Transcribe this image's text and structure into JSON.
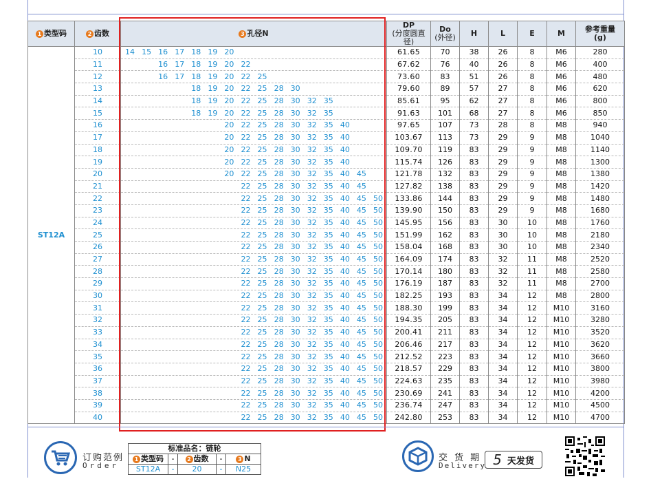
{
  "headers": {
    "type_code": "类型码",
    "teeth": "齿数",
    "bore": "孔径N",
    "dp_top": "DP",
    "dp_sub": "(分度圆直径)",
    "do_top": "Do",
    "do_sub": "(外径)",
    "h": "H",
    "l": "L",
    "e": "E",
    "m": "M",
    "weight_top": "参考重量",
    "weight_unit": "(g)",
    "num1": "1",
    "num2": "2",
    "num3": "3"
  },
  "type_value": "ST12A",
  "rows": [
    {
      "t": "10",
      "bores": [
        "14",
        "15",
        "16",
        "17",
        "18",
        "19",
        "20",
        "",
        "",
        "",
        "",
        "",
        "",
        "",
        "",
        ""
      ],
      "dp": "61.65",
      "do": "70",
      "h": "38",
      "l": "26",
      "e": "8",
      "m": "M6",
      "w": "280"
    },
    {
      "t": "11",
      "bores": [
        "",
        "",
        "16",
        "17",
        "18",
        "19",
        "20",
        "22",
        "",
        "",
        "",
        "",
        "",
        "",
        "",
        ""
      ],
      "dp": "67.62",
      "do": "76",
      "h": "40",
      "l": "26",
      "e": "8",
      "m": "M6",
      "w": "400"
    },
    {
      "t": "12",
      "bores": [
        "",
        "",
        "16",
        "17",
        "18",
        "19",
        "20",
        "22",
        "25",
        "",
        "",
        "",
        "",
        "",
        "",
        ""
      ],
      "dp": "73.60",
      "do": "83",
      "h": "51",
      "l": "26",
      "e": "8",
      "m": "M6",
      "w": "480"
    },
    {
      "t": "13",
      "bores": [
        "",
        "",
        "",
        "",
        "18",
        "19",
        "20",
        "22",
        "25",
        "28",
        "30",
        "",
        "",
        "",
        "",
        ""
      ],
      "dp": "79.60",
      "do": "89",
      "h": "57",
      "l": "27",
      "e": "8",
      "m": "M6",
      "w": "620"
    },
    {
      "t": "14",
      "bores": [
        "",
        "",
        "",
        "",
        "18",
        "19",
        "20",
        "22",
        "25",
        "28",
        "30",
        "32",
        "35",
        "",
        "",
        ""
      ],
      "dp": "85.61",
      "do": "95",
      "h": "62",
      "l": "27",
      "e": "8",
      "m": "M6",
      "w": "800"
    },
    {
      "t": "15",
      "bores": [
        "",
        "",
        "",
        "",
        "18",
        "19",
        "20",
        "22",
        "25",
        "28",
        "30",
        "32",
        "35",
        "",
        "",
        ""
      ],
      "dp": "91.63",
      "do": "101",
      "h": "68",
      "l": "27",
      "e": "8",
      "m": "M6",
      "w": "850"
    },
    {
      "t": "16",
      "bores": [
        "",
        "",
        "",
        "",
        "",
        "",
        "20",
        "22",
        "25",
        "28",
        "30",
        "32",
        "35",
        "40",
        "",
        ""
      ],
      "dp": "97.65",
      "do": "107",
      "h": "73",
      "l": "28",
      "e": "8",
      "m": "M8",
      "w": "940"
    },
    {
      "t": "17",
      "bores": [
        "",
        "",
        "",
        "",
        "",
        "",
        "20",
        "22",
        "25",
        "28",
        "30",
        "32",
        "35",
        "40",
        "",
        ""
      ],
      "dp": "103.67",
      "do": "113",
      "h": "73",
      "l": "29",
      "e": "9",
      "m": "M8",
      "w": "1040"
    },
    {
      "t": "18",
      "bores": [
        "",
        "",
        "",
        "",
        "",
        "",
        "20",
        "22",
        "25",
        "28",
        "30",
        "32",
        "35",
        "40",
        "",
        ""
      ],
      "dp": "109.70",
      "do": "119",
      "h": "83",
      "l": "29",
      "e": "9",
      "m": "M8",
      "w": "1140"
    },
    {
      "t": "19",
      "bores": [
        "",
        "",
        "",
        "",
        "",
        "",
        "20",
        "22",
        "25",
        "28",
        "30",
        "32",
        "35",
        "40",
        "",
        ""
      ],
      "dp": "115.74",
      "do": "126",
      "h": "83",
      "l": "29",
      "e": "9",
      "m": "M8",
      "w": "1300"
    },
    {
      "t": "20",
      "bores": [
        "",
        "",
        "",
        "",
        "",
        "",
        "20",
        "22",
        "25",
        "28",
        "30",
        "32",
        "35",
        "40",
        "45",
        ""
      ],
      "dp": "121.78",
      "do": "132",
      "h": "83",
      "l": "29",
      "e": "9",
      "m": "M8",
      "w": "1380"
    },
    {
      "t": "21",
      "bores": [
        "",
        "",
        "",
        "",
        "",
        "",
        "",
        "22",
        "25",
        "28",
        "30",
        "32",
        "35",
        "40",
        "45",
        ""
      ],
      "dp": "127.82",
      "do": "138",
      "h": "83",
      "l": "29",
      "e": "9",
      "m": "M8",
      "w": "1420"
    },
    {
      "t": "22",
      "bores": [
        "",
        "",
        "",
        "",
        "",
        "",
        "",
        "22",
        "25",
        "28",
        "30",
        "32",
        "35",
        "40",
        "45",
        "50"
      ],
      "dp": "133.86",
      "do": "144",
      "h": "83",
      "l": "29",
      "e": "9",
      "m": "M8",
      "w": "1480"
    },
    {
      "t": "23",
      "bores": [
        "",
        "",
        "",
        "",
        "",
        "",
        "",
        "22",
        "25",
        "28",
        "30",
        "32",
        "35",
        "40",
        "45",
        "50"
      ],
      "dp": "139.90",
      "do": "150",
      "h": "83",
      "l": "29",
      "e": "9",
      "m": "M8",
      "w": "1680"
    },
    {
      "t": "24",
      "bores": [
        "",
        "",
        "",
        "",
        "",
        "",
        "",
        "22",
        "25",
        "28",
        "30",
        "32",
        "35",
        "40",
        "45",
        "50"
      ],
      "dp": "145.95",
      "do": "156",
      "h": "83",
      "l": "30",
      "e": "10",
      "m": "M8",
      "w": "1760"
    },
    {
      "t": "25",
      "bores": [
        "",
        "",
        "",
        "",
        "",
        "",
        "",
        "22",
        "25",
        "28",
        "30",
        "32",
        "35",
        "40",
        "45",
        "50"
      ],
      "dp": "151.99",
      "do": "162",
      "h": "83",
      "l": "30",
      "e": "10",
      "m": "M8",
      "w": "2180"
    },
    {
      "t": "26",
      "bores": [
        "",
        "",
        "",
        "",
        "",
        "",
        "",
        "22",
        "25",
        "28",
        "30",
        "32",
        "35",
        "40",
        "45",
        "50"
      ],
      "dp": "158.04",
      "do": "168",
      "h": "83",
      "l": "30",
      "e": "10",
      "m": "M8",
      "w": "2340"
    },
    {
      "t": "27",
      "bores": [
        "",
        "",
        "",
        "",
        "",
        "",
        "",
        "22",
        "25",
        "28",
        "30",
        "32",
        "35",
        "40",
        "45",
        "50"
      ],
      "dp": "164.09",
      "do": "174",
      "h": "83",
      "l": "32",
      "e": "11",
      "m": "M8",
      "w": "2520"
    },
    {
      "t": "28",
      "bores": [
        "",
        "",
        "",
        "",
        "",
        "",
        "",
        "22",
        "25",
        "28",
        "30",
        "32",
        "35",
        "40",
        "45",
        "50"
      ],
      "dp": "170.14",
      "do": "180",
      "h": "83",
      "l": "32",
      "e": "11",
      "m": "M8",
      "w": "2580"
    },
    {
      "t": "29",
      "bores": [
        "",
        "",
        "",
        "",
        "",
        "",
        "",
        "22",
        "25",
        "28",
        "30",
        "32",
        "35",
        "40",
        "45",
        "50"
      ],
      "dp": "176.19",
      "do": "187",
      "h": "83",
      "l": "32",
      "e": "11",
      "m": "M8",
      "w": "2700"
    },
    {
      "t": "30",
      "bores": [
        "",
        "",
        "",
        "",
        "",
        "",
        "",
        "22",
        "25",
        "28",
        "30",
        "32",
        "35",
        "40",
        "45",
        "50"
      ],
      "dp": "182.25",
      "do": "193",
      "h": "83",
      "l": "34",
      "e": "12",
      "m": "M8",
      "w": "2800"
    },
    {
      "t": "31",
      "bores": [
        "",
        "",
        "",
        "",
        "",
        "",
        "",
        "22",
        "25",
        "28",
        "30",
        "32",
        "35",
        "40",
        "45",
        "50"
      ],
      "dp": "188.30",
      "do": "199",
      "h": "83",
      "l": "34",
      "e": "12",
      "m": "M10",
      "w": "3160"
    },
    {
      "t": "32",
      "bores": [
        "",
        "",
        "",
        "",
        "",
        "",
        "",
        "22",
        "25",
        "28",
        "30",
        "32",
        "35",
        "40",
        "45",
        "50"
      ],
      "dp": "194.35",
      "do": "205",
      "h": "83",
      "l": "34",
      "e": "12",
      "m": "M10",
      "w": "3280"
    },
    {
      "t": "33",
      "bores": [
        "",
        "",
        "",
        "",
        "",
        "",
        "",
        "22",
        "25",
        "28",
        "30",
        "32",
        "35",
        "40",
        "45",
        "50"
      ],
      "dp": "200.41",
      "do": "211",
      "h": "83",
      "l": "34",
      "e": "12",
      "m": "M10",
      "w": "3520"
    },
    {
      "t": "34",
      "bores": [
        "",
        "",
        "",
        "",
        "",
        "",
        "",
        "22",
        "25",
        "28",
        "30",
        "32",
        "35",
        "40",
        "45",
        "50"
      ],
      "dp": "206.46",
      "do": "217",
      "h": "83",
      "l": "34",
      "e": "12",
      "m": "M10",
      "w": "3620"
    },
    {
      "t": "35",
      "bores": [
        "",
        "",
        "",
        "",
        "",
        "",
        "",
        "22",
        "25",
        "28",
        "30",
        "32",
        "35",
        "40",
        "45",
        "50"
      ],
      "dp": "212.52",
      "do": "223",
      "h": "83",
      "l": "34",
      "e": "12",
      "m": "M10",
      "w": "3660"
    },
    {
      "t": "36",
      "bores": [
        "",
        "",
        "",
        "",
        "",
        "",
        "",
        "22",
        "25",
        "28",
        "30",
        "32",
        "35",
        "40",
        "45",
        "50"
      ],
      "dp": "218.57",
      "do": "229",
      "h": "83",
      "l": "34",
      "e": "12",
      "m": "M10",
      "w": "3800"
    },
    {
      "t": "37",
      "bores": [
        "",
        "",
        "",
        "",
        "",
        "",
        "",
        "22",
        "25",
        "28",
        "30",
        "32",
        "35",
        "40",
        "45",
        "50"
      ],
      "dp": "224.63",
      "do": "235",
      "h": "83",
      "l": "34",
      "e": "12",
      "m": "M10",
      "w": "3980"
    },
    {
      "t": "38",
      "bores": [
        "",
        "",
        "",
        "",
        "",
        "",
        "",
        "22",
        "25",
        "28",
        "30",
        "32",
        "35",
        "40",
        "45",
        "50"
      ],
      "dp": "230.69",
      "do": "241",
      "h": "83",
      "l": "34",
      "e": "12",
      "m": "M10",
      "w": "4200"
    },
    {
      "t": "39",
      "bores": [
        "",
        "",
        "",
        "",
        "",
        "",
        "",
        "22",
        "25",
        "28",
        "30",
        "32",
        "35",
        "40",
        "45",
        "50"
      ],
      "dp": "236.74",
      "do": "247",
      "h": "83",
      "l": "34",
      "e": "12",
      "m": "M10",
      "w": "4500"
    },
    {
      "t": "40",
      "bores": [
        "",
        "",
        "",
        "",
        "",
        "",
        "",
        "22",
        "25",
        "28",
        "30",
        "32",
        "35",
        "40",
        "45",
        "50"
      ],
      "dp": "242.80",
      "do": "253",
      "h": "83",
      "l": "34",
      "e": "12",
      "m": "M10",
      "w": "4700"
    }
  ],
  "order": {
    "title": "订购范例",
    "subtitle": "Order",
    "example_title": "标准品名：链轮",
    "col_type": "类型码",
    "col_teeth": "齿数",
    "col_n": "N",
    "dash": "-",
    "val_type": "ST12A",
    "val_teeth": "20",
    "val_n": "N25",
    "icon": "cart-icon"
  },
  "delivery": {
    "title": "交 货 期",
    "subtitle": "Delivery",
    "days": "5",
    "days_label": "天发货",
    "icon": "box-icon"
  },
  "colors": {
    "accent_blue": "#1e8fd0",
    "badge_orange": "#e77a1e",
    "highlight_red": "#e02020",
    "header_bg": "#dfe6ef"
  }
}
